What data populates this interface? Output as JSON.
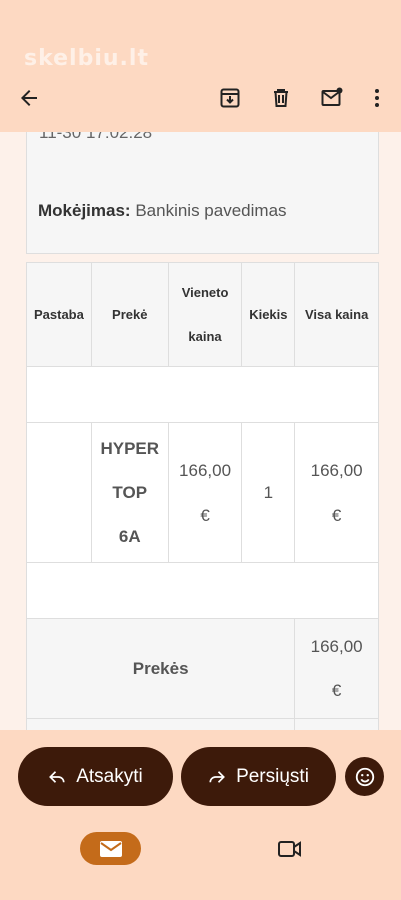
{
  "watermark": "skelbiu.lt",
  "toolbar": {
    "back_icon": "arrow-left-icon",
    "archive_icon": "archive-icon",
    "delete_icon": "trash-icon",
    "mark_unread_icon": "mail-unread-icon",
    "more_icon": "more-vert-icon"
  },
  "order": {
    "date_partial": "11-30 17:02:28",
    "payment_label": "Mokėjimas:",
    "payment_value": "Bankinis pavedimas"
  },
  "table": {
    "headers": {
      "note": "Pastaba",
      "product": "Prekė",
      "unit_price_1": "Vieneto",
      "unit_price_2": "kaina",
      "qty": "Kiekis",
      "total": "Visa kaina"
    },
    "items": [
      {
        "note": "",
        "name_lines": [
          "HYPER",
          "TOP",
          "6A"
        ],
        "unit_price_lines": [
          "166,00",
          "€"
        ],
        "qty": "1",
        "total_lines": [
          "166,00",
          "€"
        ]
      }
    ],
    "summary": {
      "label": "Prekės",
      "value_lines": [
        "166,00",
        "€"
      ]
    }
  },
  "actions": {
    "reply": "Atsakyti",
    "forward": "Persiųsti",
    "emoji_icon": "emoji-icon"
  },
  "nav": {
    "mail_icon": "mail-icon",
    "video_icon": "video-icon"
  },
  "colors": {
    "accent_dark": "#3d1a0a",
    "header_bg": "#fdd9c2",
    "nav_active": "#c46b1a"
  }
}
